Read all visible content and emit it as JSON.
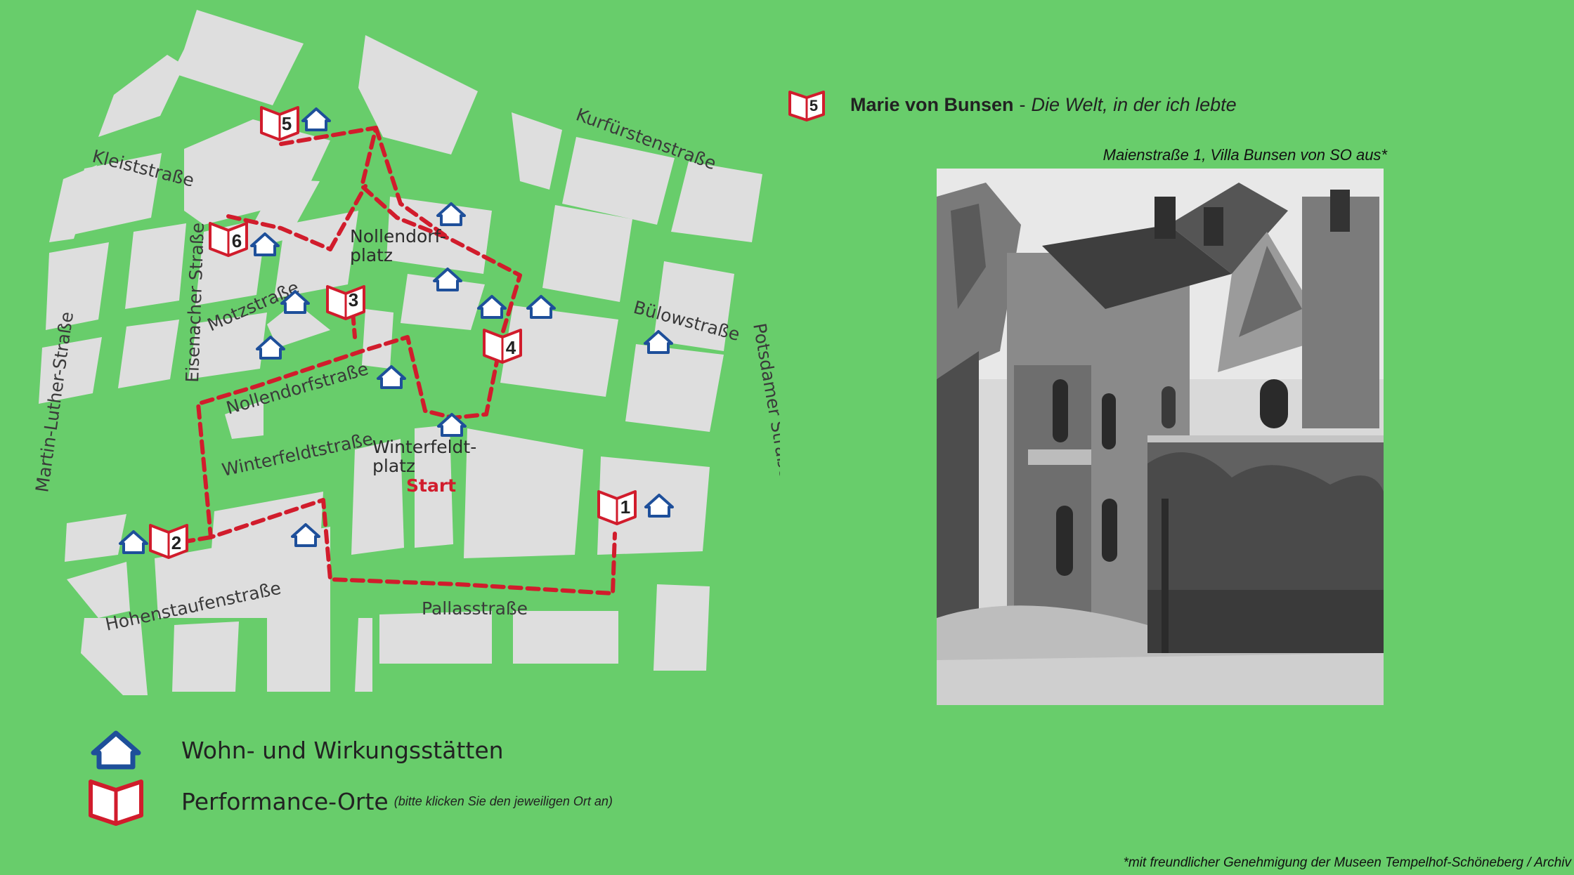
{
  "heading": {
    "location_marker": "5",
    "name": "Marie von Bunsen",
    "separator": "-",
    "work_title": "Die Welt, in der ich lebte"
  },
  "photo": {
    "caption": "Maienstraße 1, Villa Bunsen von SO aus*"
  },
  "credit": "*mit freundlicher Genehmigung der Museen Tempelhof-Schöneberg / Archiv",
  "legend": {
    "residence_label": "Wohn- und Wirkungsstätten",
    "performance_label": "Performance-Orte",
    "performance_note": "(bitte klicken Sie den jeweiligen Ort an)"
  },
  "map": {
    "streets": {
      "kleist": "Kleiststraße",
      "kurfuersten": "Kurfürstenstraße",
      "motz": "Motzstraße",
      "eisenacher": "Eisenacher Straße",
      "buelow": "Bülowstraße",
      "potsdamer": "Potsdamer Straße",
      "martin_luther": "Martin-Luther-Straße",
      "nollendorf": "Nollendorfstraße",
      "winterfeldt": "Winterfeldtstraße",
      "hohenstaufen": "Hohenstaufenstraße",
      "pallas": "Pallasstraße"
    },
    "places": {
      "nollendorfplatz_1": "Nollendorf-",
      "nollendorfplatz_2": "platz",
      "winterfeldtplatz_1": "Winterfeldt-",
      "winterfeldtplatz_2": "platz",
      "start": "Start"
    },
    "performance_sites": [
      "1",
      "2",
      "3",
      "4",
      "5",
      "6"
    ],
    "colors": {
      "background": "#68cd6b",
      "block": "#dedede",
      "route": "#d11c2c",
      "residence_icon": "#1e4f9a",
      "performance_icon": "#d11c2c"
    }
  }
}
